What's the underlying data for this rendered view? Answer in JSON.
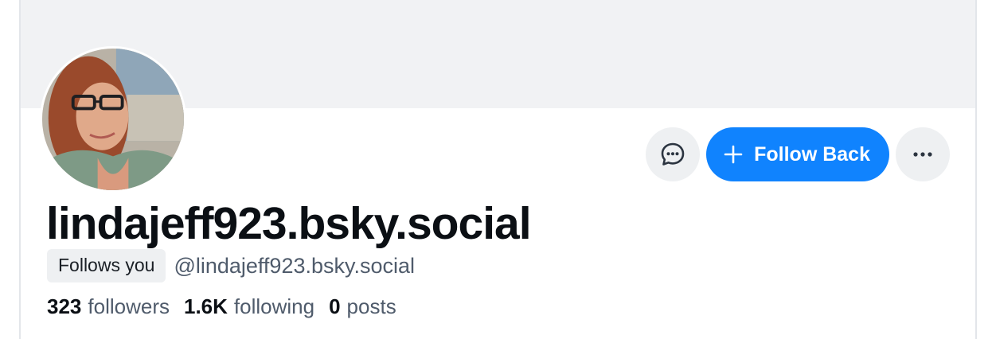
{
  "profile": {
    "display_name": "lindajeff923.bsky.social",
    "handle": "@lindajeff923.bsky.social",
    "follows_you_label": "Follows you"
  },
  "actions": {
    "message_icon": "message-icon",
    "follow_label": "Follow Back",
    "more_icon": "more-icon"
  },
  "stats": {
    "followers": {
      "value": "323",
      "label": "followers"
    },
    "following": {
      "value": "1.6K",
      "label": "following"
    },
    "posts": {
      "value": "0",
      "label": "posts"
    }
  },
  "colors": {
    "accent": "#1083fe",
    "banner": "#f1f2f4",
    "muted_text": "#4f5b6b"
  }
}
